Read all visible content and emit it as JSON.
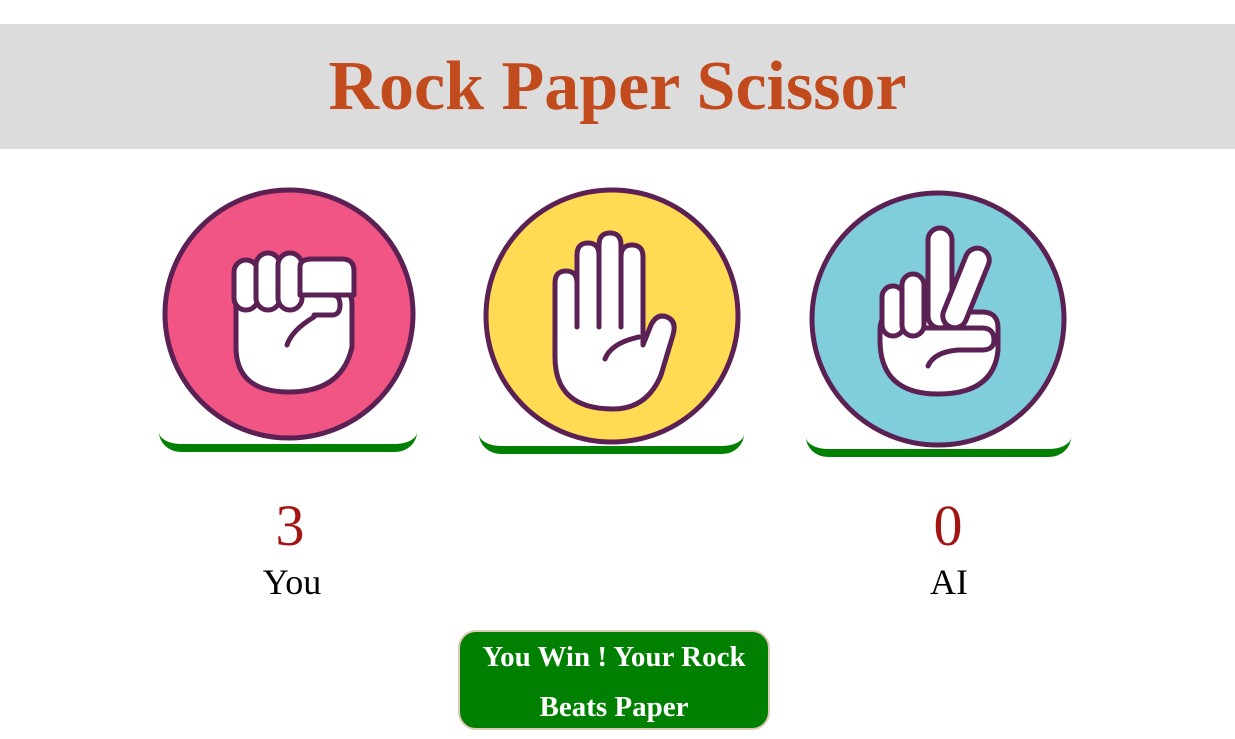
{
  "header": {
    "title": "Rock Paper Scissor"
  },
  "choices": [
    {
      "name": "rock",
      "icon": "fist-icon",
      "color": "#f05584"
    },
    {
      "name": "paper",
      "icon": "open-hand-icon",
      "color": "#fedb52"
    },
    {
      "name": "scissor",
      "icon": "victory-hand-icon",
      "color": "#80cedc"
    }
  ],
  "colors": {
    "title": "#c24b1e",
    "header_bg": "#dcdcdc",
    "outline": "#5b2154",
    "underline": "#008000",
    "score": "#a31515",
    "result_bg": "#008000"
  },
  "scoreboard": {
    "you": {
      "score": "3",
      "label": "You"
    },
    "ai": {
      "score": "0",
      "label": "AI"
    }
  },
  "result": {
    "message": "You Win ! Your Rock Beats Paper"
  }
}
